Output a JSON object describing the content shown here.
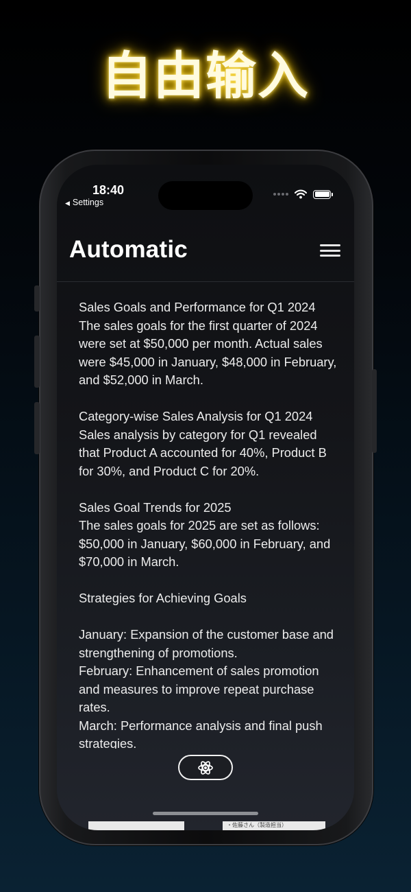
{
  "promo": {
    "headline": "自由输入"
  },
  "status_bar": {
    "time": "18:40",
    "back_label": "Settings"
  },
  "header": {
    "title": "Automatic"
  },
  "editor": {
    "text": "Sales Goals and Performance for Q1 2024\nThe sales goals for the first quarter of 2024 were set at $50,000 per month. Actual sales were $45,000 in January, $48,000 in February, and $52,000 in March.\n\nCategory-wise Sales Analysis for Q1 2024\nSales analysis by category for Q1 revealed that Product A accounted for 40%, Product B for 30%, and Product C for 20%.\n\nSales Goal Trends for 2025\nThe sales goals for 2025 are set as follows: $50,000 in January, $60,000 in February, and $70,000 in March.\n\nStrategies for Achieving Goals\n\nJanuary: Expansion of the customer base and strengthening of promotions.\nFebruary: Enhancement of sales promotion and measures to improve repeat purchase rates.\nMarch: Performance analysis and final push strategies."
  },
  "bottom": {
    "peek_text": "・佐藤さん（製造担当）"
  },
  "icons": {
    "ai_button": "atom-icon",
    "menu": "hamburger-menu-icon",
    "wifi": "wifi-icon",
    "battery": "battery-icon",
    "back": "back-triangle-icon"
  },
  "colors": {
    "headline_glow": "#f2c200",
    "background": "#000000",
    "text": "#ececec"
  }
}
